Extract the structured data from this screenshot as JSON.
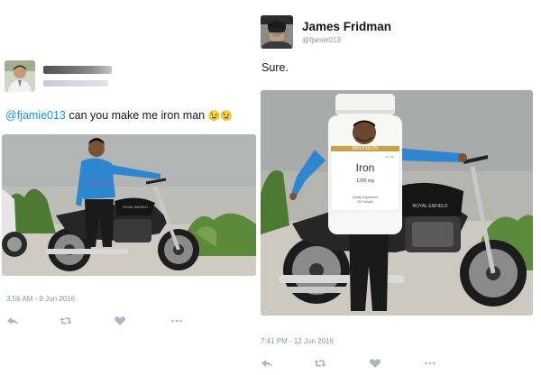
{
  "left_tweet": {
    "handle": "@fjamie013",
    "message": " can you make  me iron man",
    "emoji": "😉😉",
    "timestamp": "3:56 AM - 9 Jun 2016"
  },
  "right_tweet": {
    "display_name": "James Fridman",
    "username": "@fjamie013",
    "reply_text": "Sure.",
    "bottle": {
      "brand": "BRONSON",
      "product": "Iron",
      "dose": "1200 mg",
      "no": "No. 68",
      "fine_print_1": "Dietary Supplement",
      "fine_print_2": "250 Softgels"
    },
    "bike_tank_text": "ROYAL ENFIELD",
    "timestamp": "7:41 PM - 12 Jun 2016"
  },
  "left_photo": {
    "tshirt_text": "Dreams & Path",
    "tank_text": "ROYAL ENFIELD"
  },
  "icons": [
    "reply-icon",
    "retweet-icon",
    "like-icon",
    "more-icon"
  ],
  "colors": {
    "accent": "#1b95e0",
    "meta": "#8899a6",
    "shirt": "#2f86d0"
  }
}
